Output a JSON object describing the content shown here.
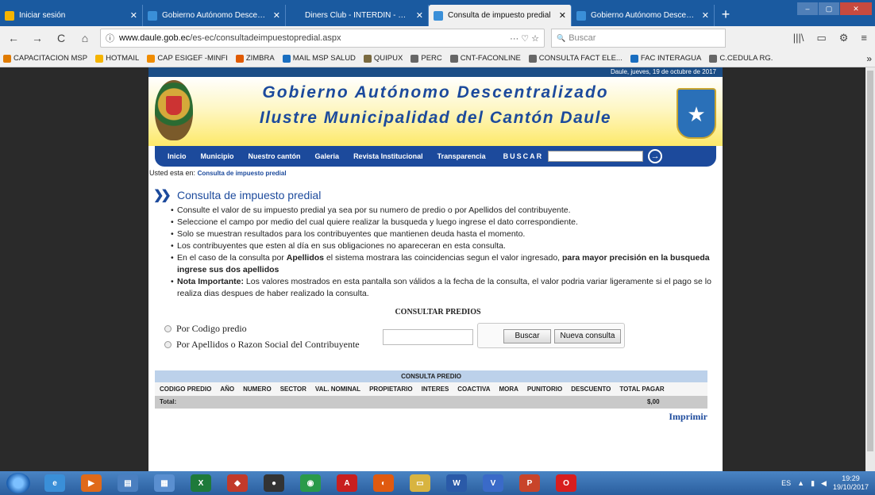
{
  "tabs": [
    {
      "label": "Iniciar sesión",
      "color": "#f5b400",
      "active": false
    },
    {
      "label": "Gobierno Autónomo Descentra",
      "color": "#3a8fd8",
      "active": false
    },
    {
      "label": "Diners Club - INTERDIN - Carga Ma",
      "color": "#1a5aa0",
      "active": false
    },
    {
      "label": "Consulta de impuesto predial",
      "color": "#3a8fd8",
      "active": true
    },
    {
      "label": "Gobierno Autónomo Descentra",
      "color": "#3a8fd8",
      "active": false
    }
  ],
  "tab_close": "✕",
  "new_tab": "+",
  "window": {
    "minimize": "–",
    "maximize": "▢",
    "close": "✕"
  },
  "nav": {
    "back": "←",
    "forward": "→",
    "reload": "C",
    "home": "⌂",
    "info": "ⓘ",
    "url_host": "www.daule.gob.ec",
    "url_path": "/es-ec/consultadeimpuestopredial.aspx",
    "url_tools": "···  ♡  ☆",
    "search_placeholder": "Buscar",
    "search_icon": "🔍",
    "tool_library": "|||\\",
    "tool_reader": "▭",
    "tool_ext": "⚙",
    "tool_menu": "≡"
  },
  "bookmarks": [
    {
      "label": "CAPACITACION MSP",
      "color": "#e07b00"
    },
    {
      "label": "HOTMAIL",
      "color": "#f5b400"
    },
    {
      "label": "CAP ESIGEF -MINFI",
      "color": "#f08c00"
    },
    {
      "label": "ZIMBRA",
      "color": "#e05a00"
    },
    {
      "label": "MAIL MSP SALUD",
      "color": "#1a6ec0"
    },
    {
      "label": "QUIPUX",
      "color": "#7a6a40"
    },
    {
      "label": "PERC",
      "color": "#666"
    },
    {
      "label": "CNT-FACONLINE",
      "color": "#666"
    },
    {
      "label": "CONSULTA FACT ELE...",
      "color": "#666"
    },
    {
      "label": "FAC INTERAGUA",
      "color": "#1a6ec0"
    },
    {
      "label": "C.CEDULA RG.",
      "color": "#666"
    }
  ],
  "bookmarks_more": "»",
  "site": {
    "date": "Daule, jueves, 19 de octubre de 2017",
    "title1": "Gobierno Autónomo Descentralizado",
    "title2": "Ilustre Municipalidad del Cantón Daule",
    "menu": [
      "Inicio",
      "Municipio",
      "Nuestro cantón",
      "Galeria",
      "Revista Institucional",
      "Transparencia"
    ],
    "buscar_label": "BUSCAR",
    "go": "→",
    "crumb_prefix": "Usted esta en:",
    "crumb_here": "Consulta de impuesto predial",
    "heading": "Consulta de impuesto predial",
    "bullets": [
      {
        "pre": "Consulte el valor de su impuesto predial ya sea por su numero de predio o por Apellidos del contribuyente.",
        "bold": "",
        "post": ""
      },
      {
        "pre": "Seleccione el campo por medio del cual quiere realizar la busqueda y luego ingrese el dato correspondiente.",
        "bold": "",
        "post": ""
      },
      {
        "pre": "Solo se muestran resultados para los contribuyentes que mantienen deuda hasta el momento.",
        "bold": "",
        "post": ""
      },
      {
        "pre": "Los contribuyentes que esten al día en sus obligaciones no apareceran en esta consulta.",
        "bold": "",
        "post": ""
      },
      {
        "pre": "En el caso de la consulta por ",
        "bold": "Apellidos",
        "post": " el sistema mostrara las coincidencias segun el valor ingresado, ",
        "bold2": "para mayor precisión en la busqueda ingrese sus dos apellidos"
      },
      {
        "pre": "",
        "bold": "Nota Importante:",
        "post": " Los valores mostrados en esta pantalla son válidos a la fecha de la consulta, el valor podria variar ligeramente si el pago se lo realiza dias despues de haber realizado la consulta."
      }
    ],
    "consult_title": "CONSULTAR PREDIOS",
    "radio1": "Por Codigo predio",
    "radio2": "Por Apellidos o Razon Social del Contribuyente",
    "btn_search": "Buscar",
    "btn_new": "Nueva consulta",
    "results_head": "CONSULTA PREDIO",
    "columns": [
      "CODIGO PREDIO",
      "AÑO",
      "NUMERO",
      "SECTOR",
      "VAL. NOMINAL",
      "PROPIETARIO",
      "INTERES",
      "COACTIVA",
      "MORA",
      "PUNITORIO",
      "DESCUENTO",
      "TOTAL PAGAR"
    ],
    "total_label": "Total:",
    "total_value": "$,00",
    "print": "Imprimir"
  },
  "taskbar": {
    "apps": [
      {
        "name": "ie",
        "glyph": "e",
        "color": "#3a8fd8"
      },
      {
        "name": "media",
        "glyph": "▶",
        "color": "#e06a1a"
      },
      {
        "name": "folder",
        "glyph": "▤",
        "color": "#4a7fc0"
      },
      {
        "name": "notepad",
        "glyph": "▦",
        "color": "#5a8fd0"
      },
      {
        "name": "excel",
        "glyph": "X",
        "color": "#1e7a3a"
      },
      {
        "name": "app-a",
        "glyph": "◆",
        "color": "#c23a2a"
      },
      {
        "name": "app-b",
        "glyph": "●",
        "color": "#333"
      },
      {
        "name": "chrome",
        "glyph": "◉",
        "color": "#2a9a4a"
      },
      {
        "name": "acrobat",
        "glyph": "A",
        "color": "#c81f1f"
      },
      {
        "name": "firefox",
        "glyph": "◐",
        "color": "#e05a10"
      },
      {
        "name": "explorer",
        "glyph": "▭",
        "color": "#d8b440"
      },
      {
        "name": "word",
        "glyph": "W",
        "color": "#2a5aa8"
      },
      {
        "name": "visio",
        "glyph": "V",
        "color": "#3a6ac8"
      },
      {
        "name": "powerpoint",
        "glyph": "P",
        "color": "#c8442a"
      },
      {
        "name": "opera",
        "glyph": "O",
        "color": "#d81e1e"
      }
    ],
    "lang": "ES",
    "time": "19:29",
    "date": "19/10/2017"
  }
}
